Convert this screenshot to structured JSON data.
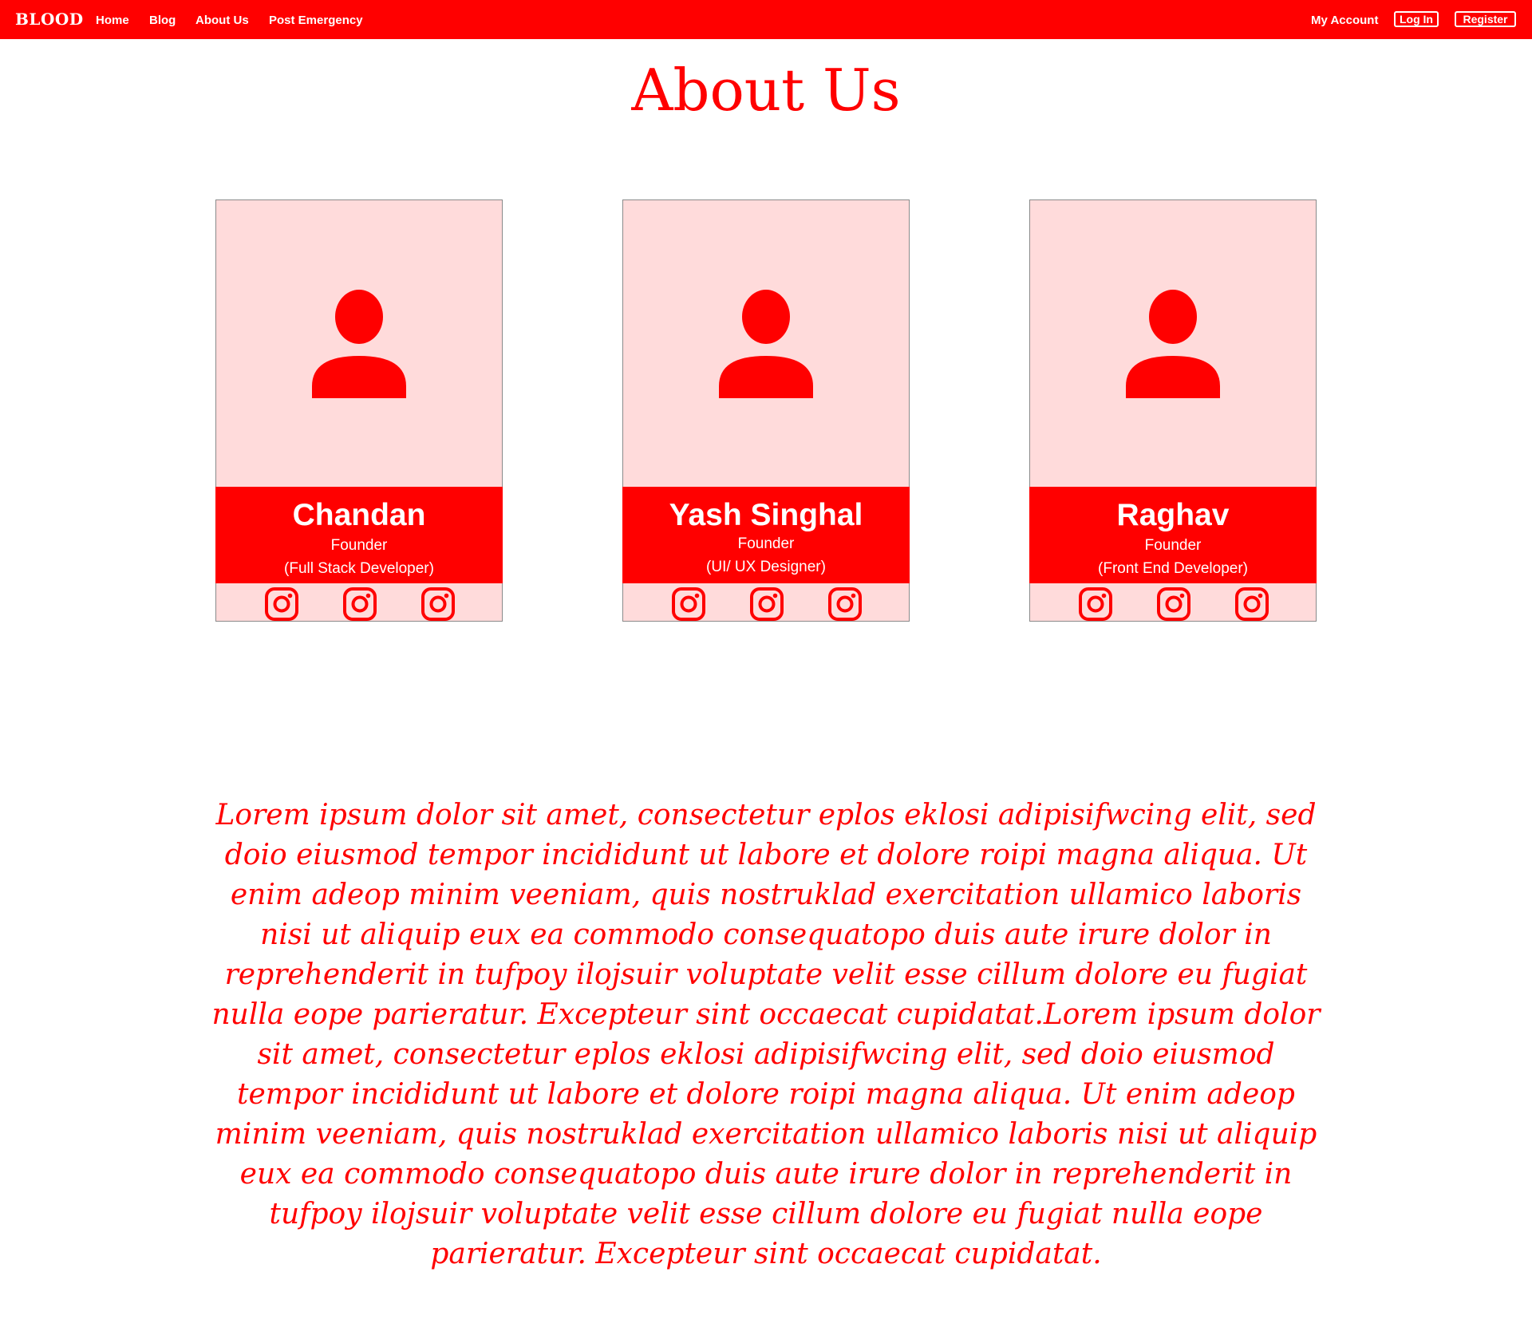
{
  "nav": {
    "brand": "BLOOD",
    "links": [
      "Home",
      "Blog",
      "About Us",
      "Post Emergency"
    ],
    "account": "My Account",
    "login": "Log In",
    "register": "Register"
  },
  "page": {
    "title": "About Us"
  },
  "members": [
    {
      "name": "Chandan",
      "role": "Founder",
      "specialty": "(Full Stack Developer)",
      "avatar_icon": "person-icon",
      "social_icons": [
        "instagram-icon",
        "instagram-icon",
        "instagram-icon"
      ]
    },
    {
      "name": "Yash Singhal",
      "role": "Founder",
      "specialty": "(UI/ UX Designer)",
      "avatar_icon": "person-icon",
      "social_icons": [
        "instagram-icon",
        "instagram-icon",
        "instagram-icon"
      ]
    },
    {
      "name": "Raghav",
      "role": "Founder",
      "specialty": "(Front End Developer)",
      "avatar_icon": "person-icon",
      "social_icons": [
        "instagram-icon",
        "instagram-icon",
        "instagram-icon"
      ]
    }
  ],
  "about_text": "Lorem ipsum dolor sit amet, consectetur eplos eklosi adipisifwcing elit, sed doio eiusmod tempor incididunt ut labore et dolore roipi magna aliqua. Ut enim adeop minim veeniam, quis nostruklad exercitation ullamico laboris nisi ut aliquip eux ea commodo consequatopo duis aute irure dolor in reprehenderit in tufpoy ilojsuir voluptate velit esse cillum dolore eu fugiat nulla eope parieratur. Excepteur sint occaecat cupidatat.Lorem ipsum dolor sit amet, consectetur eplos eklosi adipisifwcing elit, sed doio eiusmod tempor incididunt ut labore et dolore roipi magna aliqua. Ut enim adeop minim veeniam, quis nostruklad exercitation ullamico laboris nisi ut aliquip eux ea commodo consequatopo duis aute irure dolor in reprehenderit in tufpoy ilojsuir voluptate velit esse cillum dolore eu fugiat nulla eope parieratur. Excepteur sint occaecat cupidatat.",
  "colors": {
    "brand_red": "#ff0000",
    "card_pink": "#ffdbdb",
    "text_white": "#ffffff"
  }
}
